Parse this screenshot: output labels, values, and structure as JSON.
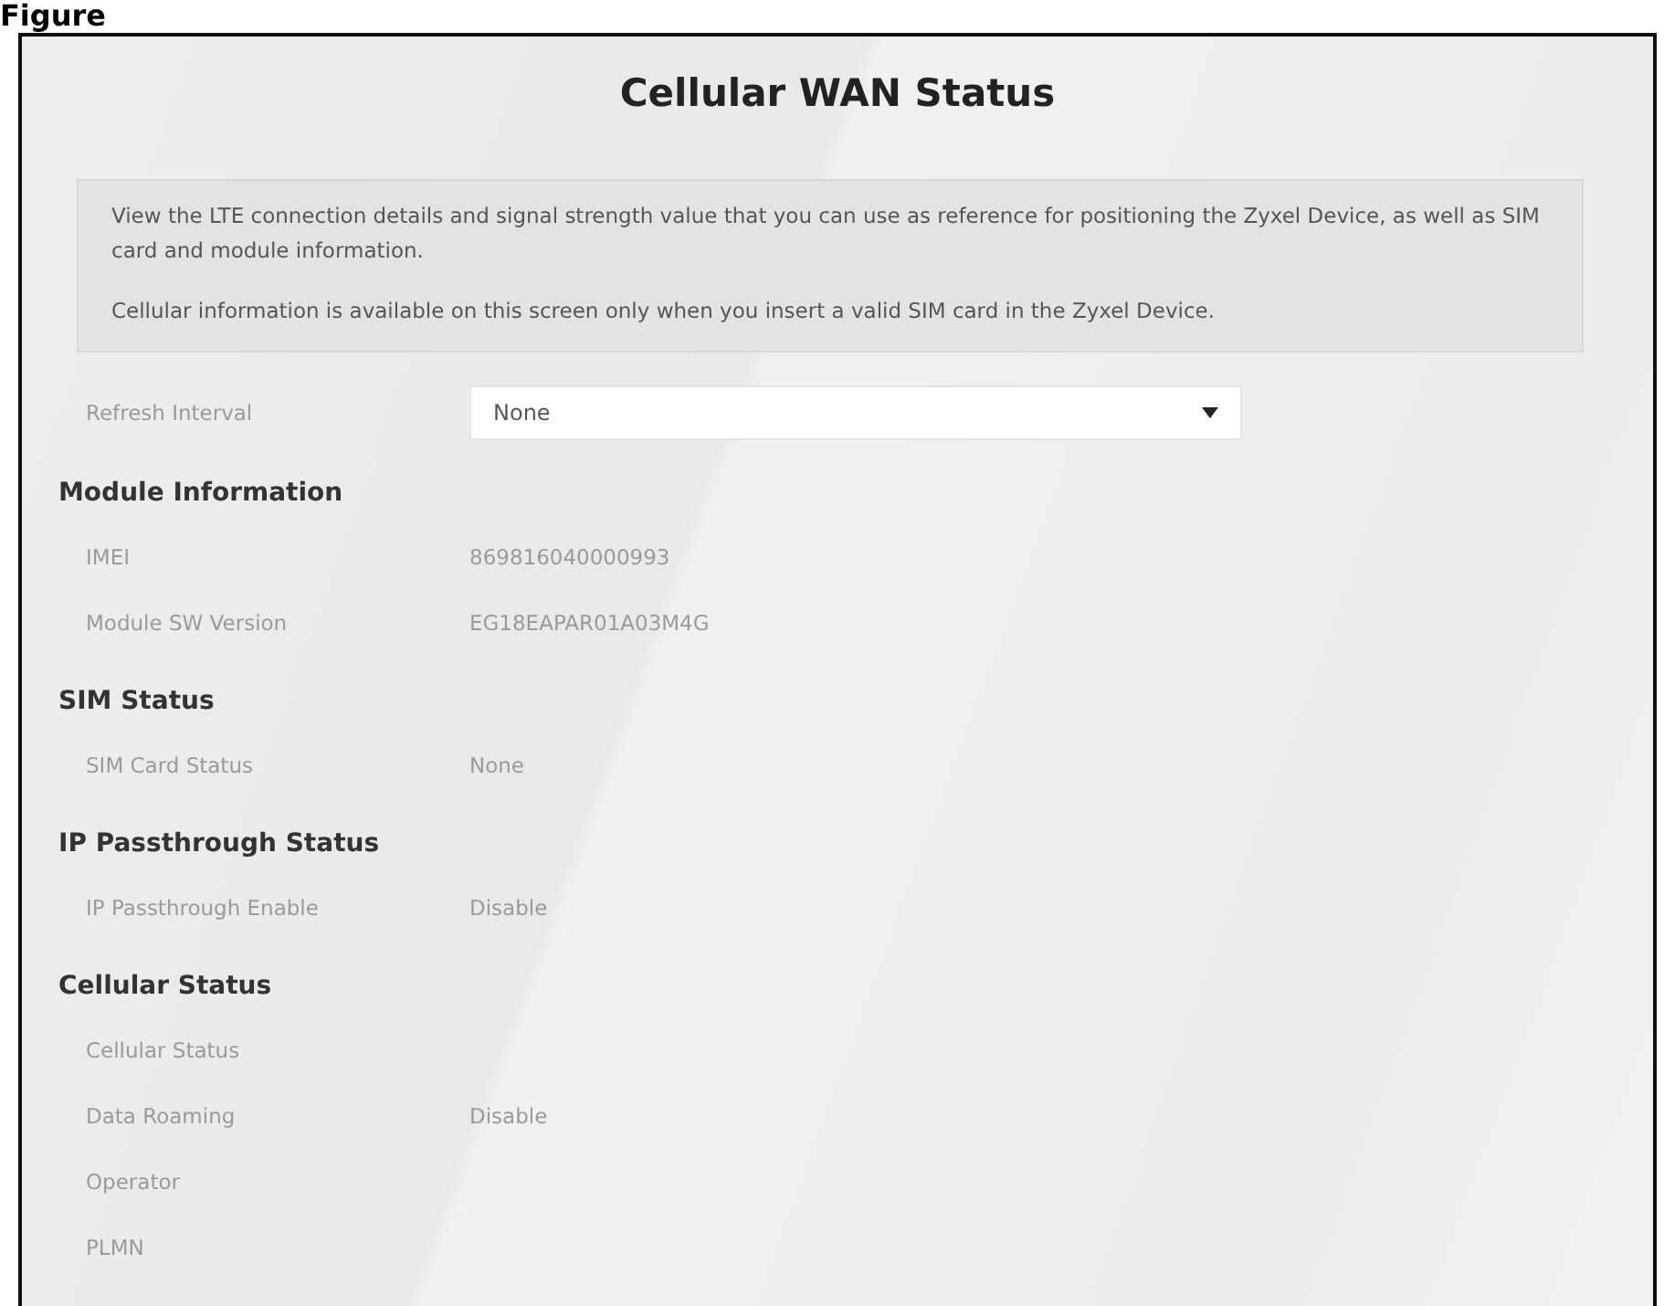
{
  "caption": "Figure",
  "title": "Cellular WAN Status",
  "info": [
    "View the LTE connection details and signal strength value that you can use as reference for positioning the Zyxel Device, as well as SIM card and module information.",
    "Cellular information is available on this screen only when you insert a valid SIM card in the Zyxel Device."
  ],
  "refresh": {
    "label": "Refresh Interval",
    "value": "None"
  },
  "sections": [
    {
      "heading": "Module Information",
      "rows": [
        {
          "label": "IMEI",
          "value": "869816040000993"
        },
        {
          "label": "Module SW Version",
          "value": "EG18EAPAR01A03M4G"
        }
      ]
    },
    {
      "heading": "SIM Status",
      "rows": [
        {
          "label": "SIM Card Status",
          "value": "None"
        }
      ]
    },
    {
      "heading": "IP Passthrough Status",
      "rows": [
        {
          "label": "IP Passthrough Enable",
          "value": "Disable"
        }
      ]
    },
    {
      "heading": "Cellular Status",
      "rows": [
        {
          "label": "Cellular Status"
        },
        {
          "label": "Data Roaming",
          "value": "Disable"
        },
        {
          "label": "Operator"
        },
        {
          "label": "PLMN"
        }
      ]
    }
  ]
}
